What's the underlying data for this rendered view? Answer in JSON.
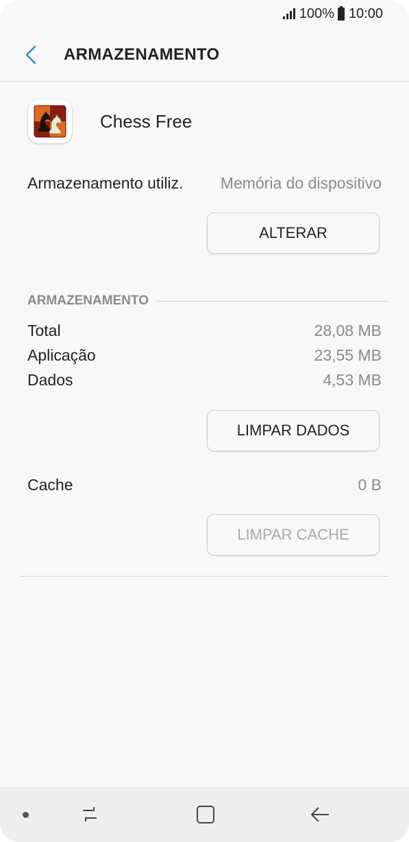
{
  "status_bar": {
    "battery": "100%",
    "time": "10:00"
  },
  "header": {
    "title": "ARMAZENAMENTO"
  },
  "app": {
    "name": "Chess Free"
  },
  "storage_used": {
    "label": "Armazenamento utiliz.",
    "value": "Memória do dispositivo"
  },
  "change_button": {
    "label": "ALTERAR"
  },
  "storage_section": {
    "title": "ARMAZENAMENTO",
    "rows": [
      {
        "label": "Total",
        "value": "28,08 MB"
      },
      {
        "label": "Aplicação",
        "value": "23,55 MB"
      },
      {
        "label": "Dados",
        "value": "4,53 MB"
      }
    ]
  },
  "clear_data_button": {
    "label": "LIMPAR DADOS"
  },
  "cache": {
    "label": "Cache",
    "value": "0 B"
  },
  "clear_cache_button": {
    "label": "LIMPAR CACHE",
    "enabled": false
  },
  "colors": {
    "accent": "#3a8fa8",
    "background": "#f8f8f8",
    "text_primary": "#222222",
    "text_secondary": "#8a8a8a"
  },
  "icons": [
    "signal-icon",
    "battery-icon",
    "back-arrow-icon",
    "chess-app-icon",
    "recent-apps-icon",
    "home-icon",
    "back-icon"
  ]
}
